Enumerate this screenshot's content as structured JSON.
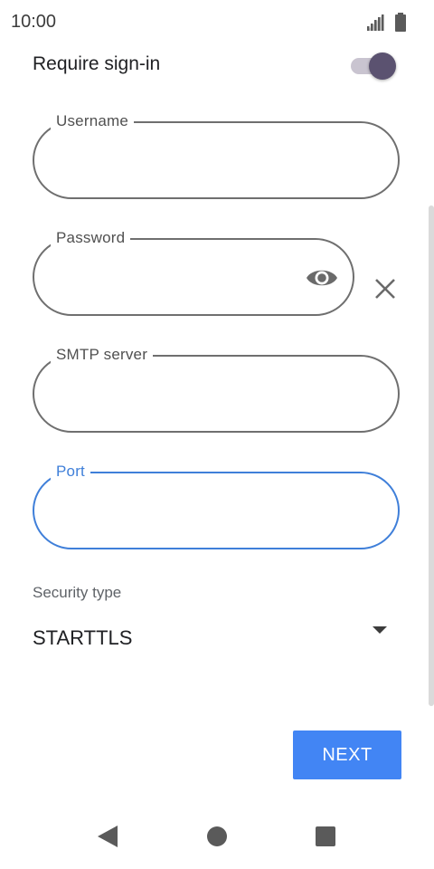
{
  "status_bar": {
    "time": "10:00",
    "icons": [
      "signal-icon",
      "battery-icon"
    ]
  },
  "require_signin": {
    "label": "Require sign-in",
    "enabled": true
  },
  "fields": {
    "username": {
      "label": "Username",
      "value": ""
    },
    "password": {
      "label": "Password",
      "value": ""
    },
    "smtp_server": {
      "label": "SMTP server",
      "value": ""
    },
    "port": {
      "label": "Port",
      "value": "",
      "focused": true
    }
  },
  "security": {
    "label": "Security type",
    "value": "STARTTLS"
  },
  "next_button": {
    "label": "NEXT"
  },
  "colors": {
    "accent": "#4285f4",
    "focus": "#3f7fd9",
    "toggle_thumb": "#5b5270",
    "toggle_track": "#c9c4d0"
  },
  "nav_bar": {
    "icons": [
      "back-icon",
      "home-icon",
      "recents-icon"
    ]
  }
}
